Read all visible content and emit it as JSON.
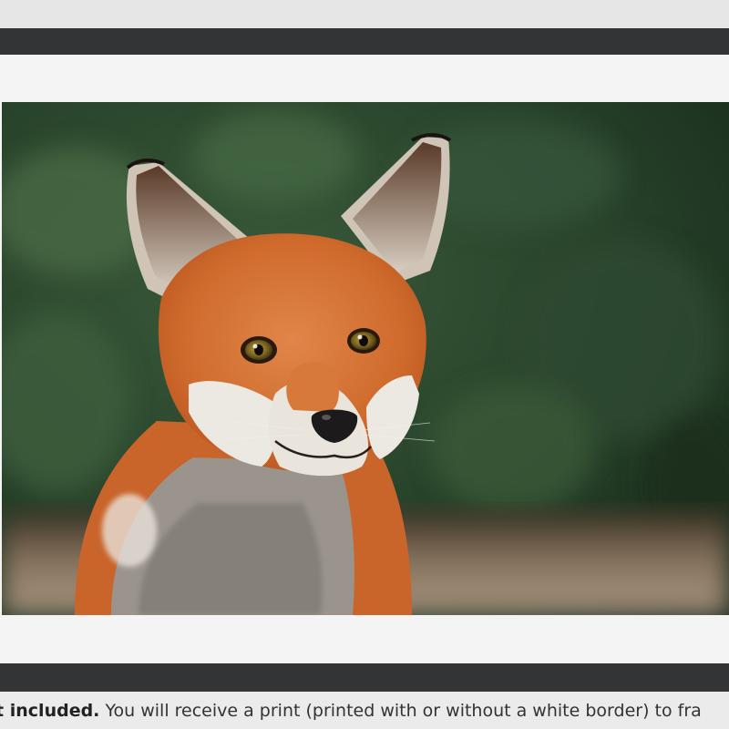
{
  "caption": {
    "bold_text": "ot included.",
    "text": " You will receive a print (printed with or without a white border) to fra"
  },
  "photo": {
    "subject": "red fox",
    "background": "blurred green foliage",
    "colors": {
      "frame": "#333435",
      "mat": "#f4f4f4",
      "foliage_dark": "#1f3a22",
      "fur_orange": "#d0682a",
      "fur_white": "#ece8e2"
    }
  }
}
